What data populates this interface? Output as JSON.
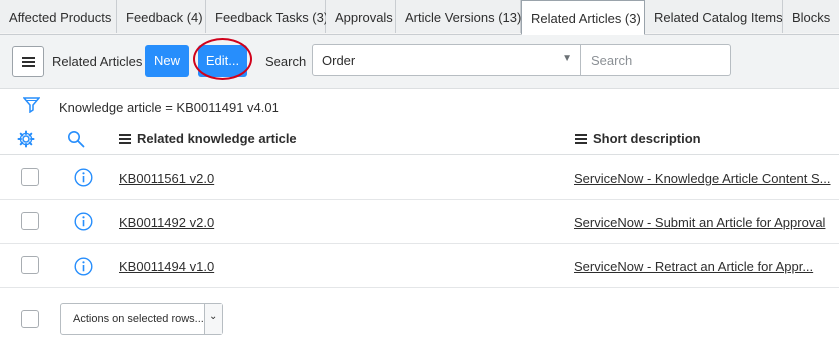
{
  "tabs": [
    {
      "label": "Affected Products",
      "active": false
    },
    {
      "label": "Feedback (4)",
      "active": false
    },
    {
      "label": "Feedback Tasks (3)",
      "active": false
    },
    {
      "label": "Approvals",
      "active": false
    },
    {
      "label": "Article Versions (13)",
      "active": false
    },
    {
      "label": "Related Articles (3)",
      "active": true
    },
    {
      "label": "Related Catalog Items",
      "active": false
    },
    {
      "label": "Blocks",
      "active": false
    }
  ],
  "toolbar": {
    "title": "Related Articles",
    "new_label": "New",
    "edit_label": "Edit...",
    "search_label": "Search",
    "search_field_selected": "Order",
    "search_placeholder": "Search"
  },
  "filter": {
    "text": "Knowledge article = KB0011491 v4.01"
  },
  "table": {
    "columns": [
      "Related knowledge article",
      "Short description"
    ],
    "rows": [
      {
        "article": "KB0011561 v2.0",
        "description": "ServiceNow - Knowledge Article Content S..."
      },
      {
        "article": "KB0011492 v2.0",
        "description": "ServiceNow - Submit an Article for Approval"
      },
      {
        "article": "KB0011494 v1.0",
        "description": "ServiceNow - Retract an Article for Appr..."
      }
    ]
  },
  "footer": {
    "actions_label": "Actions on selected rows..."
  },
  "colors": {
    "accent": "#278efc",
    "highlight_ring": "#d0021b"
  }
}
